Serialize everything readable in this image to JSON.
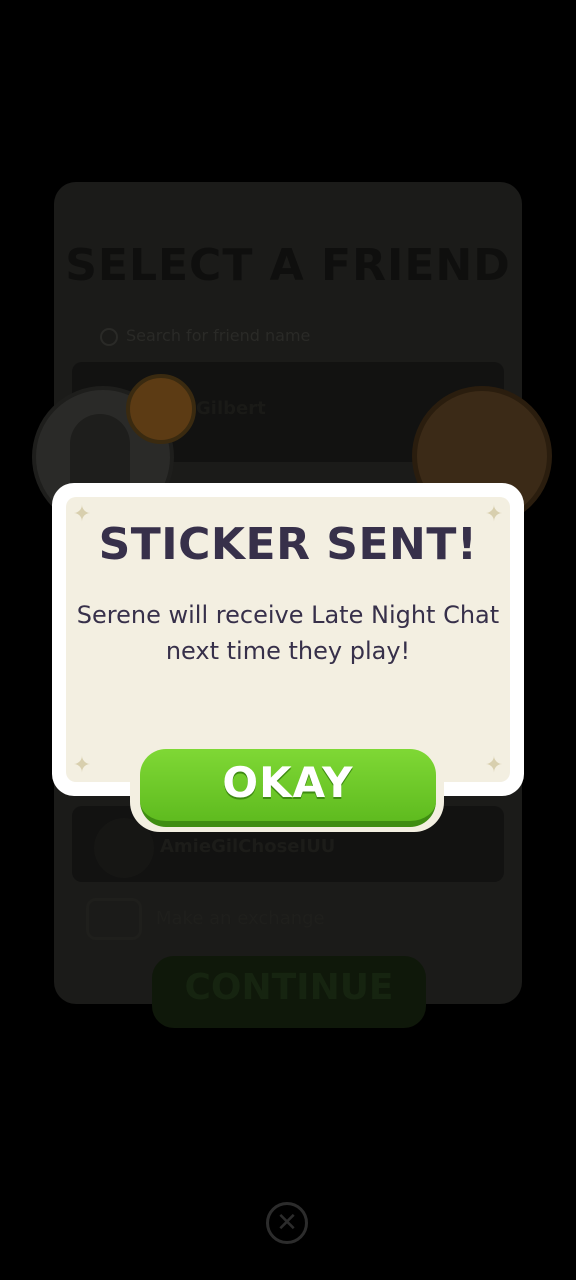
{
  "background": {
    "title": "SELECT A FRIEND",
    "search_placeholder": "Search for friend name",
    "friend_name": "Gilbert",
    "friend_name_2": "AmieGilChoseIUU",
    "exchange_label": "Make an exchange",
    "continue_label": "CONTINUE"
  },
  "modal": {
    "title": "STICKER SENT!",
    "message": "Serene will receive Late Night Chat next time they play!",
    "okay_label": "OKAY"
  },
  "close_glyph": "✕",
  "colors": {
    "modal_text": "#37304a",
    "button_green": "#6cc928",
    "modal_bg": "#f3efe1"
  }
}
